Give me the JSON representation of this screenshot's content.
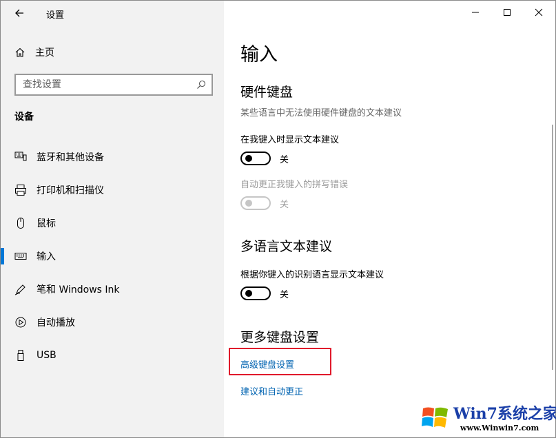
{
  "window": {
    "title": "设置",
    "back_icon": "back-arrow-icon",
    "controls": [
      "minimize-icon",
      "maximize-icon",
      "close-icon"
    ]
  },
  "sidebar": {
    "home_label": "主页",
    "search_placeholder": "查找设置",
    "group_label": "设备",
    "items": [
      {
        "label": "蓝牙和其他设备",
        "icon": "bluetooth-devices-icon",
        "active": false
      },
      {
        "label": "打印机和扫描仪",
        "icon": "printer-icon",
        "active": false
      },
      {
        "label": "鼠标",
        "icon": "mouse-icon",
        "active": false
      },
      {
        "label": "输入",
        "icon": "keyboard-icon",
        "active": true
      },
      {
        "label": "笔和 Windows Ink",
        "icon": "pen-icon",
        "active": false
      },
      {
        "label": "自动播放",
        "icon": "autoplay-icon",
        "active": false
      },
      {
        "label": "USB",
        "icon": "usb-icon",
        "active": false
      }
    ]
  },
  "main": {
    "page_title": "输入",
    "hardware_keyboard": {
      "title": "硬件键盘",
      "description": "某些语言中无法使用硬件键盘的文本建议",
      "suggestions_label": "在我键入时显示文本建议",
      "suggestions_state": "关",
      "autocorrect_label": "自动更正我键入的拼写错误",
      "autocorrect_state": "关"
    },
    "multilingual": {
      "title": "多语言文本建议",
      "label": "根据你键入的识别语言显示文本建议",
      "state": "关"
    },
    "more_keyboard": {
      "title": "更多键盘设置",
      "advanced_link": "高级键盘设置",
      "suggestions_link": "建议和自动更正"
    }
  },
  "colors": {
    "accent": "#0078d7",
    "link": "#0063b1",
    "highlight_box": "#e0192b",
    "sidebar_bg": "#f2f2f2"
  },
  "watermark": {
    "brand": "Win7系统之家",
    "url": "www.Winwin7.com"
  }
}
